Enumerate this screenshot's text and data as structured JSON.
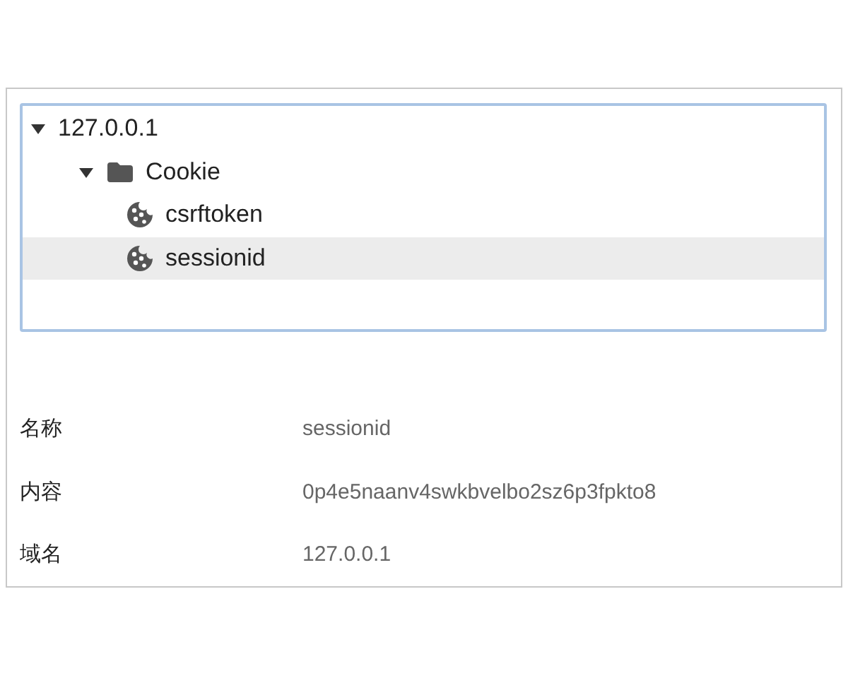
{
  "tree": [
    {
      "label": "127.0.0.1",
      "expanded": true,
      "selected": false,
      "children": [
        {
          "label": "Cookie",
          "kind": "folder",
          "expanded": true,
          "selected": false,
          "children": [
            {
              "label": "csrftoken",
              "kind": "cookie",
              "selected": false
            },
            {
              "label": "sessionid",
              "kind": "cookie",
              "selected": true
            }
          ]
        }
      ]
    }
  ],
  "details": [
    {
      "label": "名称",
      "value": "sessionid"
    },
    {
      "label": "内容",
      "value": "0p4e5naanv4swkbvelbo2sz6p3fpkto8"
    },
    {
      "label": "域名",
      "value": "127.0.0.1"
    }
  ]
}
